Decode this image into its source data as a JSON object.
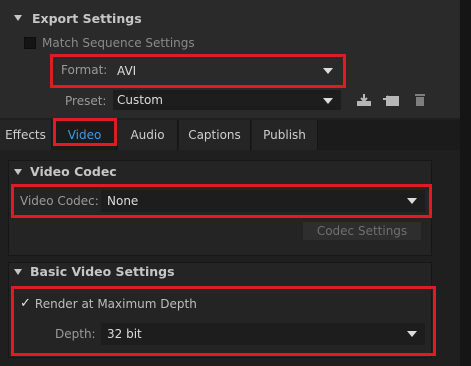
{
  "export_settings": {
    "title": "Export Settings",
    "match_sequence_label": "Match Sequence Settings",
    "format_label": "Format:",
    "format_value": "AVI",
    "preset_label": "Preset:",
    "preset_value": "Custom",
    "icons": [
      "save-preset-icon",
      "import-preset-icon",
      "delete-preset-icon"
    ]
  },
  "tabs": [
    {
      "label": "Effects",
      "active": false
    },
    {
      "label": "Video",
      "active": true
    },
    {
      "label": "Audio",
      "active": false
    },
    {
      "label": "Captions",
      "active": false
    },
    {
      "label": "Publish",
      "active": false
    }
  ],
  "video_codec": {
    "title": "Video Codec",
    "codec_label": "Video Codec:",
    "codec_value": "None",
    "settings_button": "Codec Settings"
  },
  "basic_video": {
    "title": "Basic Video Settings",
    "render_max_depth_label": "Render at Maximum Depth",
    "render_max_depth_checked": true,
    "depth_label": "Depth:",
    "depth_value": "32 bit"
  },
  "colors": {
    "highlight": "#e01b24",
    "active_tab": "#3a9de8"
  }
}
